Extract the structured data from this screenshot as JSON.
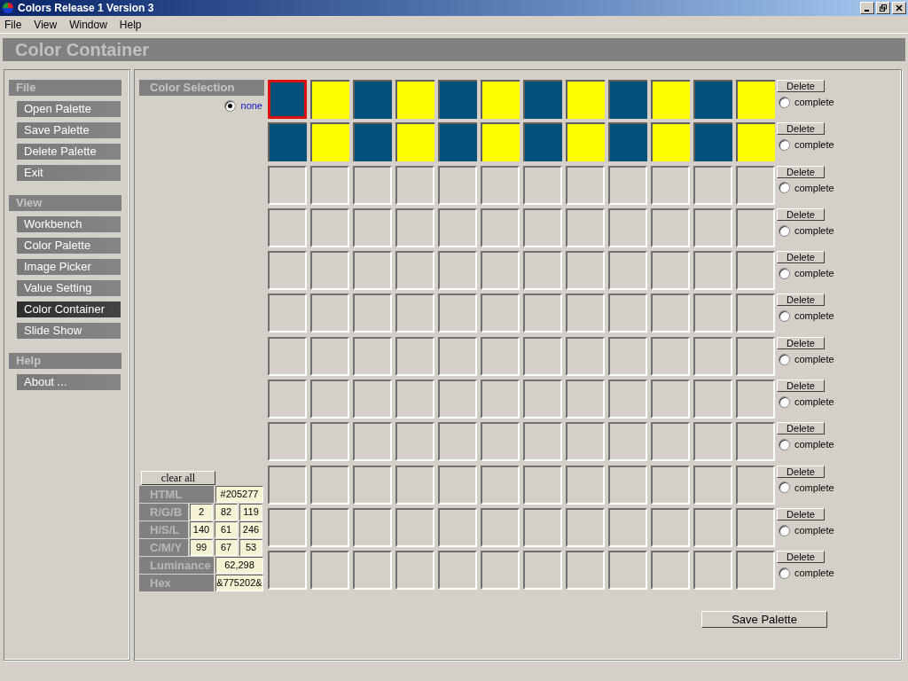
{
  "window": {
    "title": "Colors Release 1 Version 3"
  },
  "menu": [
    "File",
    "View",
    "Window",
    "Help"
  ],
  "page_title": "Color Container",
  "sidebar": [
    {
      "heading": "File",
      "items": [
        {
          "label": "Open Palette",
          "selected": false
        },
        {
          "label": "Save Palette",
          "selected": false
        },
        {
          "label": "Delete Palette",
          "selected": false
        },
        {
          "label": "Exit",
          "selected": false
        }
      ]
    },
    {
      "heading": "View",
      "items": [
        {
          "label": "Workbench",
          "selected": false
        },
        {
          "label": "Color Palette",
          "selected": false
        },
        {
          "label": "Image Picker",
          "selected": false
        },
        {
          "label": "Value Setting",
          "selected": false
        },
        {
          "label": "Color Container",
          "selected": true
        },
        {
          "label": "Slide Show",
          "selected": false
        }
      ]
    },
    {
      "heading": "Help",
      "items": [
        {
          "label": "About ...",
          "selected": false
        }
      ]
    }
  ],
  "color_selection": {
    "heading": "Color Selection",
    "option": {
      "label": "none",
      "selected": true
    }
  },
  "clear_button": "clear all",
  "values": [
    {
      "label": "HTML",
      "fields": [
        "#205277"
      ]
    },
    {
      "label": "R/G/B",
      "fields": [
        "2",
        "82",
        "119"
      ]
    },
    {
      "label": "H/S/L",
      "fields": [
        "140",
        "61",
        "246"
      ]
    },
    {
      "label": "C/M/Y",
      "fields": [
        "99",
        "67",
        "53"
      ]
    },
    {
      "label": "Luminance",
      "fields": [
        "62,298"
      ]
    },
    {
      "label": "Hex",
      "fields": [
        "&775202&"
      ]
    }
  ],
  "rows": [
    {
      "delete": "Delete",
      "complete_label": "complete",
      "complete": false,
      "swatches": [
        {
          "color": "#03507a",
          "selected": true
        },
        {
          "color": "#ffff00",
          "selected": false
        },
        {
          "color": "#03507a",
          "selected": false
        },
        {
          "color": "#ffff00",
          "selected": false
        },
        {
          "color": "#03507a",
          "selected": false
        },
        {
          "color": "#ffff00",
          "selected": false
        },
        {
          "color": "#03507a",
          "selected": false
        },
        {
          "color": "#ffff00",
          "selected": false
        },
        {
          "color": "#03507a",
          "selected": false
        },
        {
          "color": "#ffff00",
          "selected": false
        },
        {
          "color": "#03507a",
          "selected": false
        },
        {
          "color": "#ffff00",
          "selected": false
        }
      ]
    },
    {
      "delete": "Delete",
      "complete_label": "complete",
      "complete": false,
      "swatches": [
        {
          "color": "#03507a",
          "selected": false
        },
        {
          "color": "#ffff00",
          "selected": false
        },
        {
          "color": "#03507a",
          "selected": false
        },
        {
          "color": "#ffff00",
          "selected": false
        },
        {
          "color": "#03507a",
          "selected": false
        },
        {
          "color": "#ffff00",
          "selected": false
        },
        {
          "color": "#03507a",
          "selected": false
        },
        {
          "color": "#ffff00",
          "selected": false
        },
        {
          "color": "#03507a",
          "selected": false
        },
        {
          "color": "#ffff00",
          "selected": false
        },
        {
          "color": "#03507a",
          "selected": false
        },
        {
          "color": "#ffff00",
          "selected": false
        }
      ]
    },
    {
      "delete": "Delete",
      "complete_label": "complete",
      "complete": false,
      "swatches": [
        {
          "selected": false
        },
        {
          "selected": false
        },
        {
          "selected": false
        },
        {
          "selected": false
        },
        {
          "selected": false
        },
        {
          "selected": false
        },
        {
          "selected": false
        },
        {
          "selected": false
        },
        {
          "selected": false
        },
        {
          "selected": false
        },
        {
          "selected": false
        },
        {
          "selected": false
        }
      ]
    },
    {
      "delete": "Delete",
      "complete_label": "complete",
      "complete": false,
      "swatches": [
        {
          "selected": false
        },
        {
          "selected": false
        },
        {
          "selected": false
        },
        {
          "selected": false
        },
        {
          "selected": false
        },
        {
          "selected": false
        },
        {
          "selected": false
        },
        {
          "selected": false
        },
        {
          "selected": false
        },
        {
          "selected": false
        },
        {
          "selected": false
        },
        {
          "selected": false
        }
      ]
    },
    {
      "delete": "Delete",
      "complete_label": "complete",
      "complete": false,
      "swatches": [
        {
          "selected": false
        },
        {
          "selected": false
        },
        {
          "selected": false
        },
        {
          "selected": false
        },
        {
          "selected": false
        },
        {
          "selected": false
        },
        {
          "selected": false
        },
        {
          "selected": false
        },
        {
          "selected": false
        },
        {
          "selected": false
        },
        {
          "selected": false
        },
        {
          "selected": false
        }
      ]
    },
    {
      "delete": "Delete",
      "complete_label": "complete",
      "complete": false,
      "swatches": [
        {
          "selected": false
        },
        {
          "selected": false
        },
        {
          "selected": false
        },
        {
          "selected": false
        },
        {
          "selected": false
        },
        {
          "selected": false
        },
        {
          "selected": false
        },
        {
          "selected": false
        },
        {
          "selected": false
        },
        {
          "selected": false
        },
        {
          "selected": false
        },
        {
          "selected": false
        }
      ]
    },
    {
      "delete": "Delete",
      "complete_label": "complete",
      "complete": false,
      "swatches": [
        {
          "selected": false
        },
        {
          "selected": false
        },
        {
          "selected": false
        },
        {
          "selected": false
        },
        {
          "selected": false
        },
        {
          "selected": false
        },
        {
          "selected": false
        },
        {
          "selected": false
        },
        {
          "selected": false
        },
        {
          "selected": false
        },
        {
          "selected": false
        },
        {
          "selected": false
        }
      ]
    },
    {
      "delete": "Delete",
      "complete_label": "complete",
      "complete": false,
      "swatches": [
        {
          "selected": false
        },
        {
          "selected": false
        },
        {
          "selected": false
        },
        {
          "selected": false
        },
        {
          "selected": false
        },
        {
          "selected": false
        },
        {
          "selected": false
        },
        {
          "selected": false
        },
        {
          "selected": false
        },
        {
          "selected": false
        },
        {
          "selected": false
        },
        {
          "selected": false
        }
      ]
    },
    {
      "delete": "Delete",
      "complete_label": "complete",
      "complete": false,
      "swatches": [
        {
          "selected": false
        },
        {
          "selected": false
        },
        {
          "selected": false
        },
        {
          "selected": false
        },
        {
          "selected": false
        },
        {
          "selected": false
        },
        {
          "selected": false
        },
        {
          "selected": false
        },
        {
          "selected": false
        },
        {
          "selected": false
        },
        {
          "selected": false
        },
        {
          "selected": false
        }
      ]
    },
    {
      "delete": "Delete",
      "complete_label": "complete",
      "complete": false,
      "swatches": [
        {
          "selected": false
        },
        {
          "selected": false
        },
        {
          "selected": false
        },
        {
          "selected": false
        },
        {
          "selected": false
        },
        {
          "selected": false
        },
        {
          "selected": false
        },
        {
          "selected": false
        },
        {
          "selected": false
        },
        {
          "selected": false
        },
        {
          "selected": false
        },
        {
          "selected": false
        }
      ]
    },
    {
      "delete": "Delete",
      "complete_label": "complete",
      "complete": false,
      "swatches": [
        {
          "selected": false
        },
        {
          "selected": false
        },
        {
          "selected": false
        },
        {
          "selected": false
        },
        {
          "selected": false
        },
        {
          "selected": false
        },
        {
          "selected": false
        },
        {
          "selected": false
        },
        {
          "selected": false
        },
        {
          "selected": false
        },
        {
          "selected": false
        },
        {
          "selected": false
        }
      ]
    },
    {
      "delete": "Delete",
      "complete_label": "complete",
      "complete": false,
      "swatches": [
        {
          "selected": false
        },
        {
          "selected": false
        },
        {
          "selected": false
        },
        {
          "selected": false
        },
        {
          "selected": false
        },
        {
          "selected": false
        },
        {
          "selected": false
        },
        {
          "selected": false
        },
        {
          "selected": false
        },
        {
          "selected": false
        },
        {
          "selected": false
        },
        {
          "selected": false
        }
      ]
    }
  ],
  "save_button": "Save Palette"
}
